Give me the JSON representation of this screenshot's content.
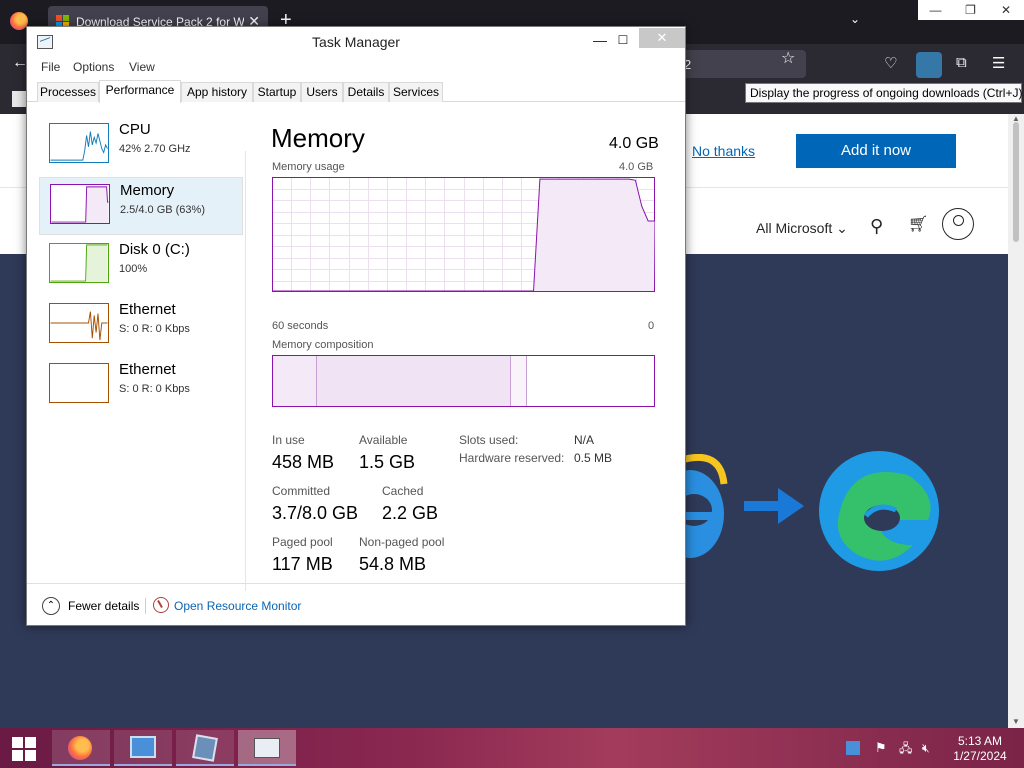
{
  "browser": {
    "tab_title": "Download Service Pack 2 for W...",
    "url_partial": "2",
    "tooltip": "Display the progress of ongoing downloads (Ctrl+J)"
  },
  "webpage": {
    "no_thanks": "No thanks",
    "add_it_now": "Add it now",
    "all_microsoft": "All Microsoft"
  },
  "taskmgr": {
    "title": "Task Manager",
    "menu": [
      "File",
      "Options",
      "View"
    ],
    "tabs": [
      "Processes",
      "Performance",
      "App history",
      "Startup",
      "Users",
      "Details",
      "Services"
    ],
    "active_tab": "Performance",
    "sidebar": [
      {
        "name": "CPU",
        "sub": "42%  2.70 GHz",
        "color": "#117dbb"
      },
      {
        "name": "Memory",
        "sub": "2.5/4.0 GB (63%)",
        "color": "#8b12ae"
      },
      {
        "name": "Disk 0 (C:)",
        "sub": "100%",
        "color": "#4da60c"
      },
      {
        "name": "Ethernet",
        "sub": "S: 0  R: 0 Kbps",
        "color": "#a74f01"
      },
      {
        "name": "Ethernet",
        "sub": "S: 0  R: 0 Kbps",
        "color": "#a74f01"
      }
    ],
    "memory": {
      "title": "Memory",
      "total": "4.0 GB",
      "usage_label": "Memory usage",
      "usage_max": "4.0 GB",
      "time_left": "60 seconds",
      "time_right": "0",
      "composition_label": "Memory composition",
      "in_use_label": "In use",
      "in_use": "458 MB",
      "available_label": "Available",
      "available": "1.5 GB",
      "committed_label": "Committed",
      "committed": "3.7/8.0 GB",
      "cached_label": "Cached",
      "cached": "2.2 GB",
      "paged_label": "Paged pool",
      "paged": "117 MB",
      "nonpaged_label": "Non-paged pool",
      "nonpaged": "54.8 MB",
      "slots_label": "Slots used:",
      "slots": "N/A",
      "hwres_label": "Hardware reserved:",
      "hwres": "0.5 MB",
      "usage_series": [
        0,
        0,
        0,
        0,
        0,
        0,
        0,
        0,
        0,
        0,
        0,
        0,
        0,
        0,
        0,
        0,
        0,
        0,
        0,
        0,
        0,
        0,
        0,
        0,
        0,
        0,
        0,
        0,
        0,
        0,
        0,
        0,
        0,
        0,
        0,
        0,
        0,
        0,
        0,
        0,
        0,
        0,
        0.99,
        0.99,
        0.99,
        0.99,
        0.99,
        0.99,
        0.99,
        0.99,
        0.99,
        0.99,
        0.99,
        0.99,
        0.99,
        0.99,
        0.99,
        0.98,
        0.75,
        0.62,
        0.62
      ]
    },
    "fewer_details": "Fewer details",
    "open_resmon": "Open Resource Monitor"
  },
  "taskbar": {
    "time": "5:13 AM",
    "date": "1/27/2024"
  }
}
